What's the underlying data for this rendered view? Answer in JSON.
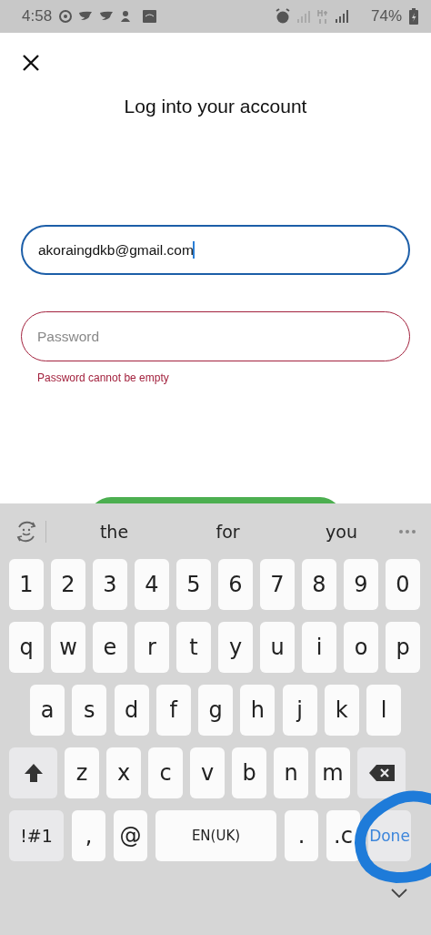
{
  "status_bar": {
    "time": "4:58",
    "battery": "74%"
  },
  "title": "Log into your account",
  "email_field": {
    "value": "akoraingdkb@gmail.com",
    "focused": true
  },
  "password_field": {
    "placeholder": "Password",
    "error": true
  },
  "error_message": "Password cannot be empty",
  "keyboard": {
    "suggestions": [
      "the",
      "for",
      "you"
    ],
    "rows": [
      {
        "keys": [
          {
            "label": "1",
            "kind": "char"
          },
          {
            "label": "2",
            "kind": "char"
          },
          {
            "label": "3",
            "kind": "char"
          },
          {
            "label": "4",
            "kind": "char"
          },
          {
            "label": "5",
            "kind": "char"
          },
          {
            "label": "6",
            "kind": "char"
          },
          {
            "label": "7",
            "kind": "char"
          },
          {
            "label": "8",
            "kind": "char"
          },
          {
            "label": "9",
            "kind": "char"
          },
          {
            "label": "0",
            "kind": "char"
          }
        ]
      },
      {
        "keys": [
          {
            "label": "q",
            "kind": "char"
          },
          {
            "label": "w",
            "kind": "char"
          },
          {
            "label": "e",
            "kind": "char"
          },
          {
            "label": "r",
            "kind": "char"
          },
          {
            "label": "t",
            "kind": "char"
          },
          {
            "label": "y",
            "kind": "char"
          },
          {
            "label": "u",
            "kind": "char"
          },
          {
            "label": "i",
            "kind": "char"
          },
          {
            "label": "o",
            "kind": "char"
          },
          {
            "label": "p",
            "kind": "char"
          }
        ]
      },
      {
        "keys": [
          {
            "label": "a",
            "kind": "char"
          },
          {
            "label": "s",
            "kind": "char"
          },
          {
            "label": "d",
            "kind": "char"
          },
          {
            "label": "f",
            "kind": "char"
          },
          {
            "label": "g",
            "kind": "char"
          },
          {
            "label": "h",
            "kind": "char"
          },
          {
            "label": "j",
            "kind": "char"
          },
          {
            "label": "k",
            "kind": "char"
          },
          {
            "label": "l",
            "kind": "char"
          }
        ]
      },
      {
        "keys": [
          {
            "kind": "shift"
          },
          {
            "label": "z",
            "kind": "char"
          },
          {
            "label": "x",
            "kind": "char"
          },
          {
            "label": "c",
            "kind": "char"
          },
          {
            "label": "v",
            "kind": "char"
          },
          {
            "label": "b",
            "kind": "char"
          },
          {
            "label": "n",
            "kind": "char"
          },
          {
            "label": "m",
            "kind": "char"
          },
          {
            "kind": "backspace"
          }
        ]
      },
      {
        "keys": [
          {
            "label": "!#1",
            "kind": "mode"
          },
          {
            "label": ",",
            "kind": "char"
          },
          {
            "label": "@",
            "kind": "char"
          },
          {
            "label": "EN(UK)",
            "kind": "space"
          },
          {
            "label": ".",
            "kind": "char"
          },
          {
            "label": ".c",
            "kind": "char"
          },
          {
            "label": "Done",
            "kind": "action"
          }
        ]
      }
    ]
  }
}
